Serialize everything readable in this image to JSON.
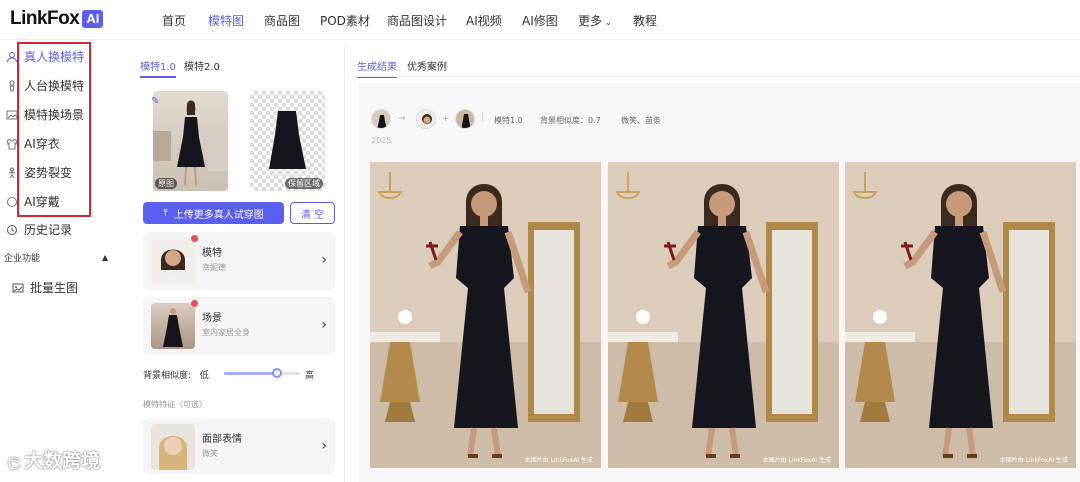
{
  "brand": {
    "name": "LinkFox",
    "badge": "AI"
  },
  "nav": [
    {
      "label": "首页"
    },
    {
      "label": "模特图",
      "active": true
    },
    {
      "label": "商品图"
    },
    {
      "label": "POD素材"
    },
    {
      "label": "商品图设计"
    },
    {
      "label": "AI视频"
    },
    {
      "label": "AI修图"
    },
    {
      "label": "更多"
    },
    {
      "label": "教程"
    }
  ],
  "sidebar": {
    "items": [
      {
        "label": "真人换模特",
        "icon": "person-swap-icon",
        "active": true
      },
      {
        "label": "人台换模特",
        "icon": "mannequin-icon"
      },
      {
        "label": "模特换场景",
        "icon": "scene-icon"
      },
      {
        "label": "AI穿衣",
        "icon": "shirt-icon"
      },
      {
        "label": "姿势裂变",
        "icon": "pose-icon"
      },
      {
        "label": "AI穿戴",
        "icon": "ring-icon"
      },
      {
        "label": "历史记录",
        "icon": "clock-icon"
      }
    ],
    "section": "企业功能",
    "batch": "批量生图"
  },
  "panel": {
    "tabs": [
      "模特1.0",
      "模特2.0"
    ],
    "orig_tag": "原图",
    "keep_tag": "保留区域",
    "upload": "上传更多真人试穿图",
    "clear": "清 空",
    "model": {
      "title": "模特",
      "sub": "幸妮德"
    },
    "scene": {
      "title": "场景",
      "sub": "室内家居全身"
    },
    "similarity": {
      "label": "背景相似度:",
      "low": "低",
      "high": "高",
      "value": 0.7
    },
    "feature_label": "模特特征（可选）",
    "face": {
      "title": "面部表情",
      "sub": "微笑"
    }
  },
  "results": {
    "tabs": [
      "生成结果",
      "优秀案例"
    ],
    "meta": [
      "模特1.0",
      "背景相似度：0.7",
      "微笑、苗条"
    ],
    "year": "2025",
    "watermark": "本图片由 LinkFoxAI 生成"
  },
  "overlay_watermark": "大数跨境",
  "colors": {
    "accent": "#5b5ff0",
    "highlight": "#d9242b"
  }
}
